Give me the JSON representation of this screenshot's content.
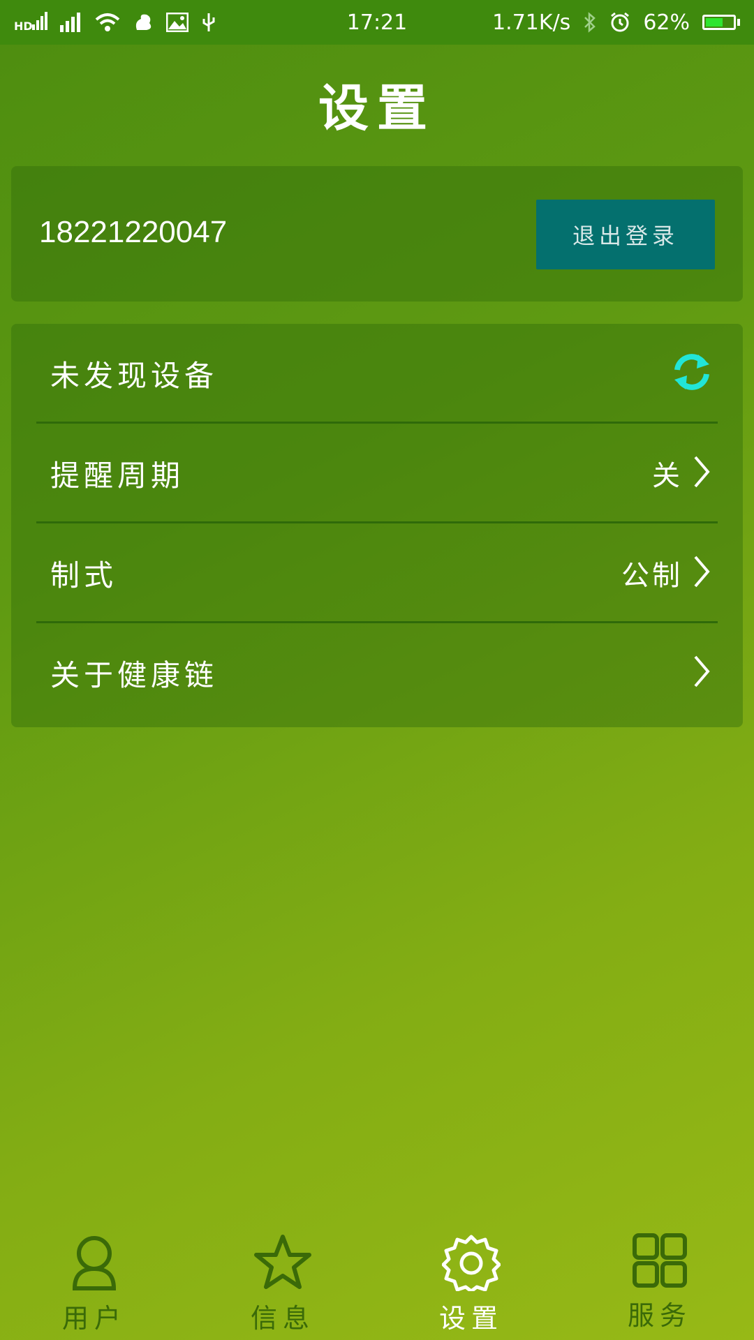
{
  "status_bar": {
    "hd_label": "HD",
    "time": "17:21",
    "network_speed": "1.71K/s",
    "battery_percent": "62%",
    "battery_level": 0.62,
    "icons": [
      "hd-signal-icon",
      "signal-icon",
      "signal-icon",
      "wifi-icon",
      "squirrel-app-icon",
      "image-icon",
      "usb-icon",
      "bluetooth-icon",
      "alarm-icon",
      "battery-icon"
    ]
  },
  "header": {
    "title": "设置"
  },
  "account": {
    "phone": "18221220047",
    "logout_label": "退出登录"
  },
  "settings": {
    "rows": [
      {
        "label": "未发现设备",
        "value": "",
        "icon": "refresh-icon"
      },
      {
        "label": "提醒周期",
        "value": "关",
        "icon": "chevron-right-icon"
      },
      {
        "label": "制式",
        "value": "公制",
        "icon": "chevron-right-icon"
      },
      {
        "label": "关于健康链",
        "value": "",
        "icon": "chevron-right-icon"
      }
    ]
  },
  "nav": {
    "items": [
      {
        "label": "用户",
        "icon": "user-icon",
        "active": false
      },
      {
        "label": "信息",
        "icon": "star-icon",
        "active": false
      },
      {
        "label": "设置",
        "icon": "gear-icon",
        "active": true
      },
      {
        "label": "服务",
        "icon": "grid-icon",
        "active": false
      }
    ]
  },
  "colors": {
    "status_bar": "#3f8a0d",
    "logout_button": "#04706e",
    "refresh_accent": "#22e5d8",
    "nav_inactive": "#3a6a08",
    "battery_fill": "#2fe52f"
  }
}
